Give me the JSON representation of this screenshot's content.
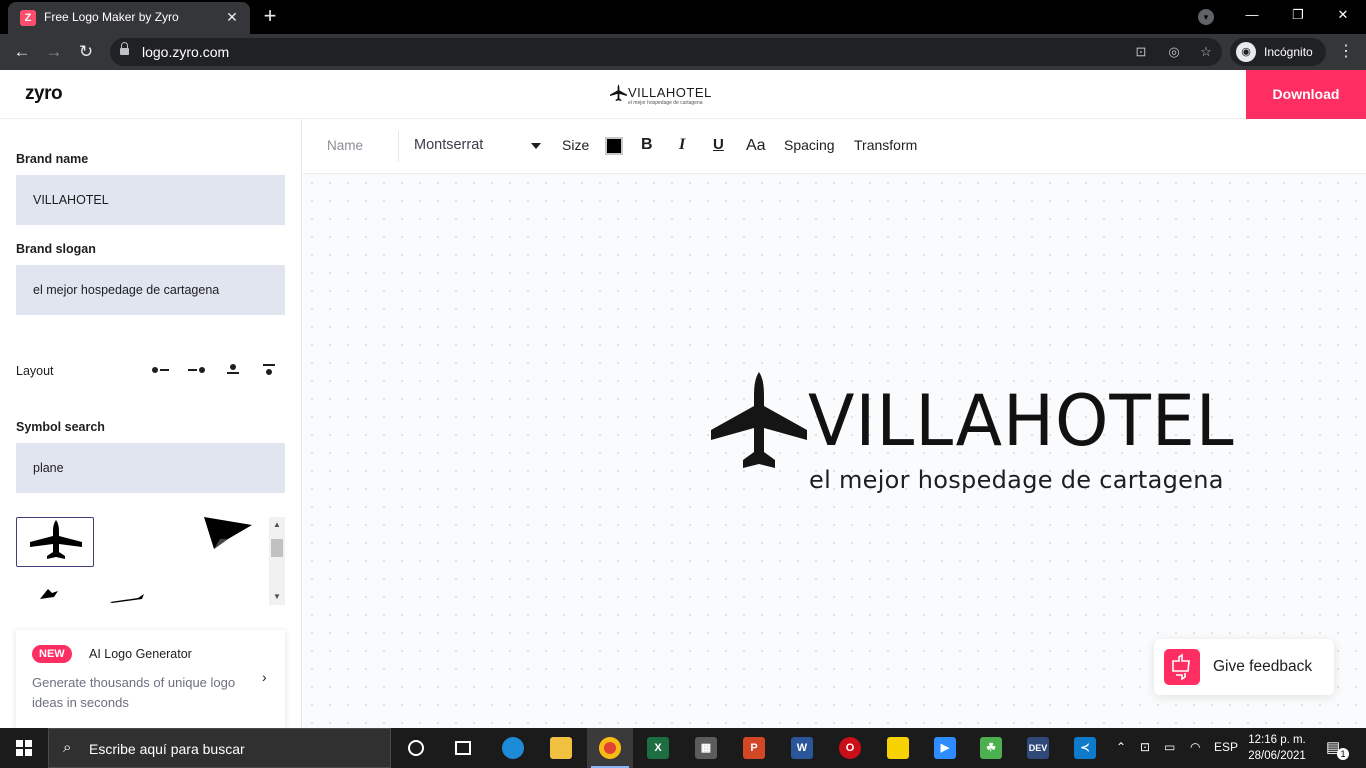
{
  "browser": {
    "tab_title": "Free Logo Maker by Zyro",
    "tab_favicon": "Z",
    "url": "logo.zyro.com",
    "profile_label": "Incógnito"
  },
  "header": {
    "app_logo": "zyro",
    "preview_name": "VILLAHOTEL",
    "preview_slogan": "el mejor hospedage de cartagena",
    "download_label": "Download"
  },
  "sidebar": {
    "brand_name_label": "Brand name",
    "brand_name_value": "VILLAHOTEL",
    "brand_slogan_label": "Brand slogan",
    "brand_slogan_value": "el mejor hospedage de cartagena",
    "layout_label": "Layout",
    "layout_options": [
      "icon-left",
      "icon-right",
      "icon-top",
      "icon-top-bar"
    ],
    "symbol_search_label": "Symbol search",
    "symbol_search_value": "plane",
    "ai_card": {
      "badge": "NEW",
      "title": "AI Logo Generator",
      "description": "Generate thousands of unique logo ideas in seconds"
    }
  },
  "toolbar": {
    "name_label": "Name",
    "font": "Montserrat",
    "size_label": "Size",
    "color": "#000000",
    "bold_label": "B",
    "italic_label": "I",
    "underline_label": "U",
    "case_label": "Aa",
    "spacing_label": "Spacing",
    "transform_label": "Transform"
  },
  "canvas": {
    "logo_name": "VILLAHOTEL",
    "logo_slogan": "el mejor hospedage de cartagena",
    "feedback_label": "Give feedback"
  },
  "taskbar": {
    "search_placeholder": "Escribe aquí para buscar",
    "language": "ESP",
    "time": "12:16 p. m.",
    "date": "28/06/2021",
    "notification_count": "1"
  },
  "colors": {
    "accent": "#fe2e63",
    "input_bg": "#e1e5ef",
    "chrome_dark": "#35363a"
  }
}
